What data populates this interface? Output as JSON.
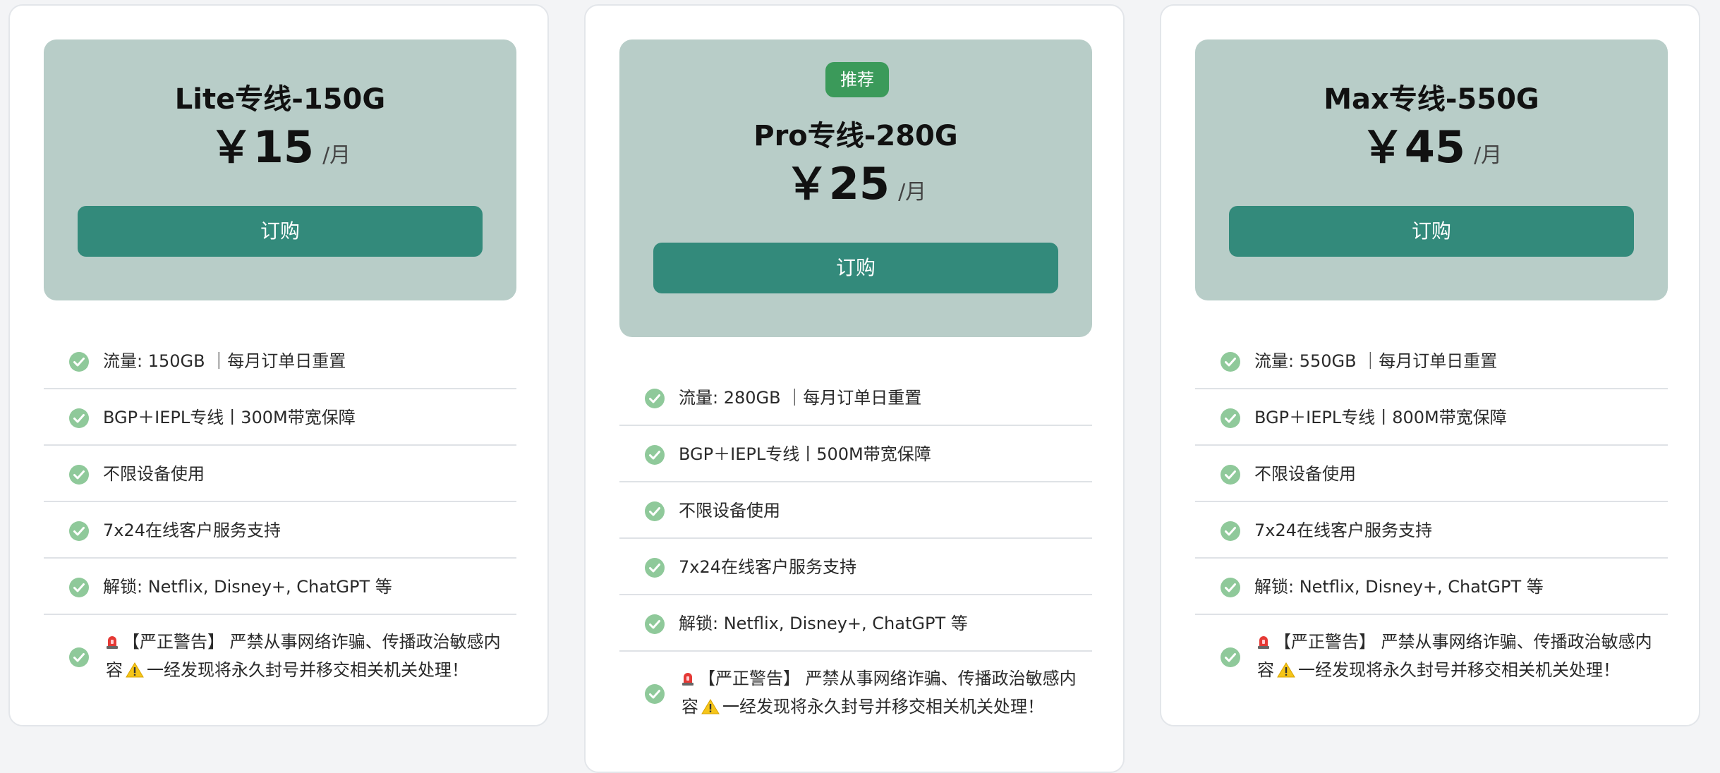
{
  "plans": [
    {
      "name": "Lite专线-150G",
      "price": "￥15",
      "unit": "/月",
      "button_label": "订购",
      "features": [
        "流量: 150GB ｜每月订单日重置",
        "BGP＋IEPL专线丨300M带宽保障",
        "不限设备使用",
        "7x24在线客户服务支持",
        "解锁: Netflix, Disney+, ChatGPT 等"
      ],
      "warning": {
        "part1": "【严正警告】 严禁从事网络诈骗、传播政治敏感内容",
        "part2": "一经发现将永久封号并移交相关机关处理！"
      }
    },
    {
      "badge": "推荐",
      "name": "Pro专线-280G",
      "price": "￥25",
      "unit": "/月",
      "button_label": "订购",
      "features": [
        "流量: 280GB ｜每月订单日重置",
        "BGP＋IEPL专线丨500M带宽保障",
        "不限设备使用",
        "7x24在线客户服务支持",
        "解锁: Netflix, Disney+, ChatGPT 等"
      ],
      "warning": {
        "part1": "【严正警告】 严禁从事网络诈骗、传播政治敏感内容",
        "part2": "一经发现将永久封号并移交相关机关处理！"
      }
    },
    {
      "name": "Max专线-550G",
      "price": "￥45",
      "unit": "/月",
      "button_label": "订购",
      "features": [
        "流量: 550GB ｜每月订单日重置",
        "BGP＋IEPL专线丨800M带宽保障",
        "不限设备使用",
        "7x24在线客户服务支持",
        "解锁: Netflix, Disney+, ChatGPT 等"
      ],
      "warning": {
        "part1": "【严正警告】 严禁从事网络诈骗、传播政治敏感内容",
        "part2": "一经发现将永久封号并移交相关机关处理！"
      }
    }
  ],
  "colors": {
    "header_bg": "#b8cdc8",
    "button_bg": "#338a7b",
    "badge_bg": "#3b9a5a",
    "check_green": "#8fc99a"
  },
  "icons": {
    "check": "check-circle-icon",
    "siren": "siren-icon",
    "caution": "warning-icon"
  }
}
